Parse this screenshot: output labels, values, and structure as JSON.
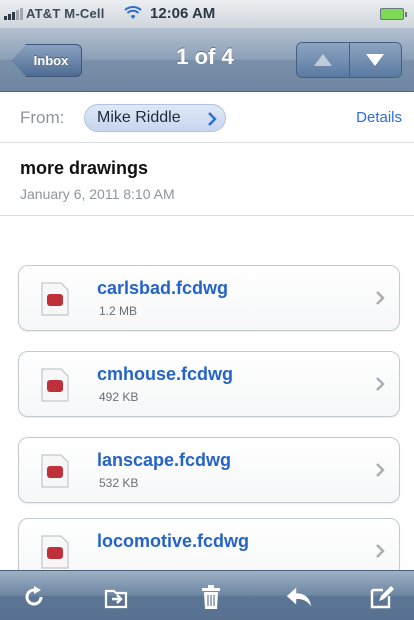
{
  "status_bar": {
    "carrier": "AT&T M-Cell",
    "time": "12:06 AM"
  },
  "nav": {
    "back_label": "Inbox",
    "title": "1 of 4"
  },
  "message": {
    "from_label": "From:",
    "sender": "Mike Riddle",
    "details_label": "Details",
    "subject": "more drawings",
    "date": "January 6, 2011 8:10 AM"
  },
  "attachments": [
    {
      "name": "carlsbad.fcdwg",
      "size": "1.2 MB"
    },
    {
      "name": "cmhouse.fcdwg",
      "size": "492 KB"
    },
    {
      "name": "lanscape.fcdwg",
      "size": "532 KB"
    },
    {
      "name": "locomotive.fcdwg",
      "size": ""
    }
  ],
  "colors": {
    "link_blue": "#2d6ed8",
    "nav_blue": "#7a90aa",
    "attachment_name": "#2563c9"
  },
  "icons": {
    "toolbar": [
      "refresh-icon",
      "move-to-folder-icon",
      "trash-icon",
      "reply-icon",
      "compose-icon"
    ]
  }
}
